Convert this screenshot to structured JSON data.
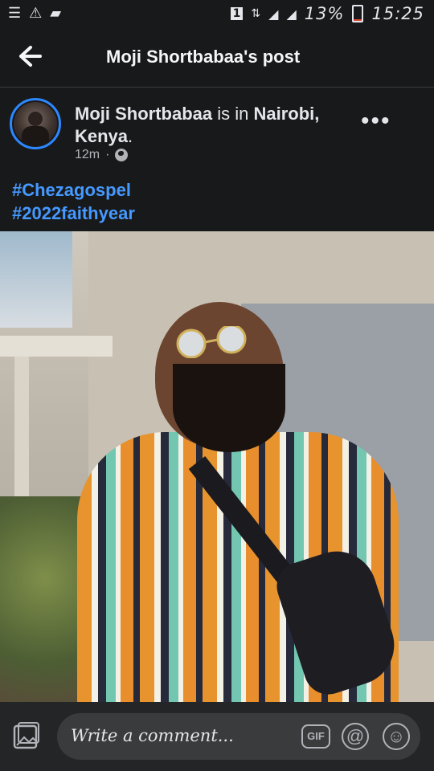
{
  "status_bar": {
    "icons": [
      "list-icon",
      "warning-icon",
      "chat-icon",
      "sim-1-icon",
      "data-arrows-icon",
      "signal-icon",
      "signal-icon"
    ],
    "sim_label": "1",
    "battery_level": "13%",
    "time": "15:25",
    "battery_fraction": 0.13,
    "battery_color": "#e24b3b"
  },
  "top_bar": {
    "title": "Moji Shortbabaa's post",
    "back_icon": "arrow-left-icon"
  },
  "post": {
    "author_name": "Moji Shortbabaa",
    "is_in_text": " is in ",
    "location": "Nairobi, Kenya",
    "period": ".",
    "time_ago": "12m",
    "separator": "·",
    "audience_icon": "globe-icon",
    "more_label": "•••",
    "hashtags": [
      "#Chezagospel",
      "#2022faithyear"
    ]
  },
  "composer": {
    "placeholder": "Write a comment...",
    "gif_label": "GIF",
    "at_label": "@",
    "emoji_label": "☺",
    "gallery_icon": "gallery-icon"
  },
  "colors": {
    "background": "#18191a",
    "accent": "#2d88ff",
    "hashtag": "#4599ff",
    "composer_bg": "#242526",
    "input_bg": "#3a3b3c"
  }
}
